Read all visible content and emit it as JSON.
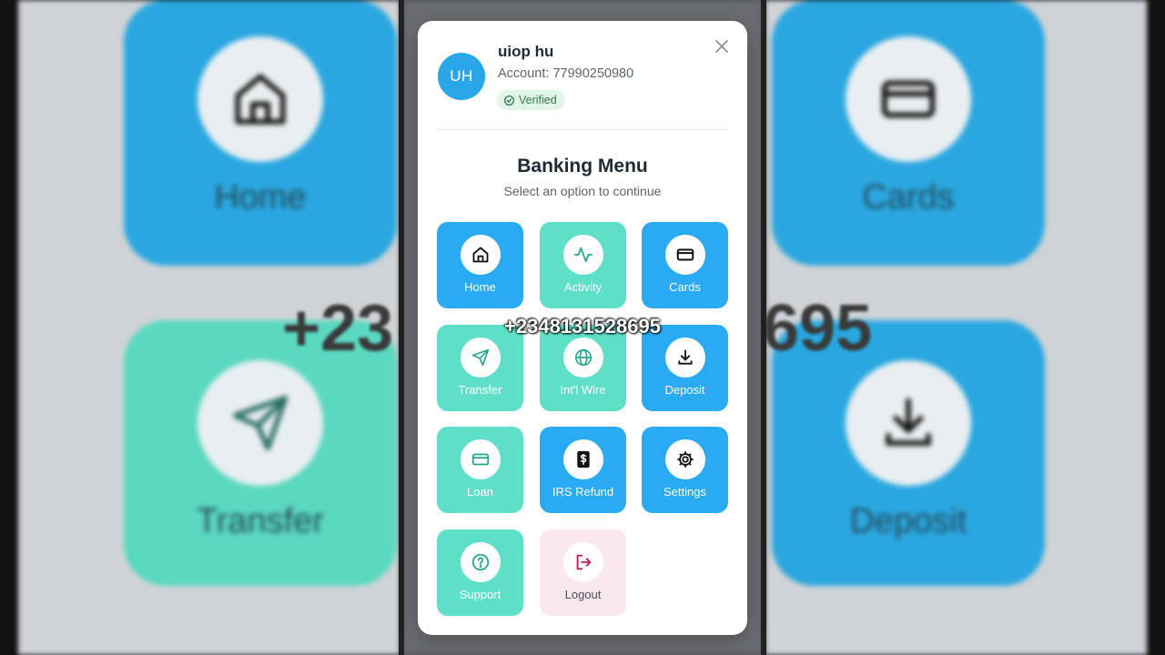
{
  "background": {
    "left_tiles": [
      {
        "label": "Home",
        "icon": "home-icon",
        "color": "#2aa7e0"
      },
      {
        "label": "Transfer",
        "icon": "send-icon",
        "color": "#5ad8c0"
      }
    ],
    "right_tiles": [
      {
        "label": "Cards",
        "icon": "card-icon",
        "color": "#2aa7e0"
      },
      {
        "label": "Deposit",
        "icon": "download-icon",
        "color": "#2aa7e0"
      }
    ],
    "phone_fragment_left": "+23",
    "phone_fragment_right": "695"
  },
  "user": {
    "initials": "UH",
    "name": "uiop hu",
    "account": "Account: 77990250980",
    "verified_label": "Verified"
  },
  "menu": {
    "title": "Banking Menu",
    "subtitle": "Select an option to continue",
    "items": [
      {
        "label": "Home",
        "icon": "home-icon",
        "style": "blue"
      },
      {
        "label": "Activity",
        "icon": "activity-icon",
        "style": "teal"
      },
      {
        "label": "Cards",
        "icon": "card-icon",
        "style": "blue"
      },
      {
        "label": "Transfer",
        "icon": "send-icon",
        "style": "teal"
      },
      {
        "label": "Int'l Wire",
        "icon": "globe-icon",
        "style": "teal"
      },
      {
        "label": "Deposit",
        "icon": "download-icon",
        "style": "blue"
      },
      {
        "label": "Loan",
        "icon": "card-icon",
        "style": "teal"
      },
      {
        "label": "IRS Refund",
        "icon": "dollar-doc-icon",
        "style": "blue"
      },
      {
        "label": "Settings",
        "icon": "gear-icon",
        "style": "blue"
      },
      {
        "label": "Support",
        "icon": "help-icon",
        "style": "teal"
      },
      {
        "label": "Logout",
        "icon": "logout-icon",
        "style": "pink"
      }
    ]
  },
  "overlay_phone": "+2348131528695",
  "colors": {
    "blue": "#2aaaf0",
    "teal": "#5ee0c8",
    "pink": "#fbe7ef",
    "verified_bg": "#e1f6e8"
  }
}
